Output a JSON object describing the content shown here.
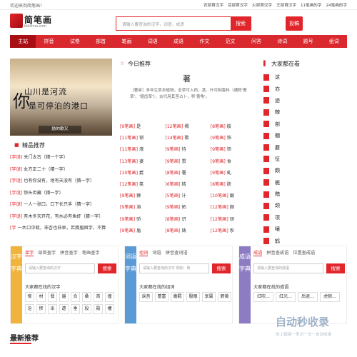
{
  "topbar": {
    "welcome": "欢迎来到简笔画！",
    "links": [
      "农部首汉字",
      "耳部首汉字",
      "火部首汉字",
      "王部首汉字",
      "11笔画的字",
      "24笔画的字"
    ]
  },
  "logo": {
    "name": "简笔画",
    "sub": "biblihua.com"
  },
  "search": {
    "placeholder": "请输入要查询的汉字，词语，成语",
    "button": "搜索"
  },
  "login": "投稿",
  "nav": [
    "主站",
    "拼音",
    "试卷",
    "部首",
    "笔画",
    "词语",
    "成语",
    "作文",
    "范文",
    "问答",
    "诗词",
    "题号",
    "组词"
  ],
  "hero": {
    "line1": "山川是河流",
    "line2": "是可停泊的港口",
    "big": "你",
    "caption": "励的歌又"
  },
  "jingpin": {
    "title": "精品推荐",
    "items": [
      {
        "tag": "[字谜]",
        "text": "关门太古（猜一个字）"
      },
      {
        "tag": "[字谜]",
        "text": "女方正二十（猜一字）"
      },
      {
        "tag": "[字谜]",
        "text": "也有你没有，地有天没有（猜一字）"
      },
      {
        "tag": "[字谜]",
        "text": "惊头否藏（猜一字）"
      },
      {
        "tag": "[字谜]",
        "text": "一人一张口，口下长只手（猜一字）"
      },
      {
        "tag": "[字谜]",
        "text": "有木冬天开花，有水必有鱼虾（猜一字）"
      },
      {
        "tag": "[字",
        "text": "一木口中栽，非杏也非呆，若猜盾困字，不算"
      }
    ]
  },
  "today": {
    "title": "今日推荐",
    "char": "著",
    "desc": "［著审］多年生草本植物，全草可入药，茎、叶可制香料（通称'蓍草'、'锯齿草'），古代用其茎占卜，称'蓍龟'。"
  },
  "strokes": [
    [
      {
        "tag": "[9笔画]",
        "c": "是"
      },
      {
        "tag": "[12笔画]",
        "c": "揭"
      },
      {
        "tag": "[8笔画]",
        "c": "肢"
      }
    ],
    [
      {
        "tag": "[11笔画]",
        "c": "锁"
      },
      {
        "tag": "[14笔画]",
        "c": "歌"
      },
      {
        "tag": "[9笔画]",
        "c": "饰"
      }
    ],
    [
      {
        "tag": "[11笔画]",
        "c": "液"
      },
      {
        "tag": "[9笔画]",
        "c": "恃"
      },
      {
        "tag": "[9笔画]",
        "c": "饰"
      }
    ],
    [
      {
        "tag": "[13笔画]",
        "c": "婆"
      },
      {
        "tag": "[9笔画]",
        "c": "贯"
      },
      {
        "tag": "[9笔画]",
        "c": "食"
      }
    ],
    [
      {
        "tag": "[10笔画]",
        "c": "爵"
      },
      {
        "tag": "[8笔画]",
        "c": "署"
      },
      {
        "tag": "[9笔画]",
        "c": "虬"
      }
    ],
    [
      {
        "tag": "[12笔画]",
        "c": "笑"
      },
      {
        "tag": "[6笔画]",
        "c": "桔"
      },
      {
        "tag": "[8笔画]",
        "c": "肤"
      }
    ],
    [
      {
        "tag": "[9笔画]",
        "c": "狮"
      },
      {
        "tag": "[5笔画]",
        "c": "汁"
      },
      {
        "tag": "[10笔画]",
        "c": "蹴"
      }
    ],
    [
      {
        "tag": "[9笔画]",
        "c": "涛"
      },
      {
        "tag": "[9笔画]",
        "c": "拓"
      },
      {
        "tag": "[12笔画]",
        "c": "颇"
      }
    ],
    [
      {
        "tag": "[9笔画]",
        "c": "骄"
      },
      {
        "tag": "[8笔画]",
        "c": "识"
      },
      {
        "tag": "[12笔画]",
        "c": "顽"
      }
    ],
    [
      {
        "tag": "[9笔画]",
        "c": "盾"
      },
      {
        "tag": "[8笔画]",
        "c": "铸"
      },
      {
        "tag": "[12笔画]",
        "c": "豕"
      }
    ]
  ],
  "hot": {
    "title": "大家都在看",
    "items": [
      "这",
      "亦",
      "迹",
      "棘",
      "剖",
      "棚",
      "蘑",
      "怔",
      "颇",
      "栀",
      "黯",
      "颉",
      "项",
      "嚷",
      "鹤"
    ]
  },
  "panels": {
    "zi": {
      "side": "汉字字典",
      "tabs": [
        "单字",
        "部首查字",
        "拼音查字",
        "笔画查字"
      ],
      "placeholder": "请输入要查询的汉字",
      "button": "搜索",
      "label": "大家都在找的汉字",
      "chars": [
        "惭",
        "材",
        "餐",
        "遍",
        "合",
        "桑",
        "首",
        "撞",
        "沧",
        "惨",
        "采",
        "遭",
        "垂",
        "段",
        "殿",
        "槽"
      ]
    },
    "ci": {
      "side": "词语字典",
      "tabs": [
        "组词",
        "词语",
        "拼音查词语"
      ],
      "placeholder": "请输入要查询的汉字 例如：阿",
      "button": "搜索",
      "label": "大家都在找的组词",
      "words": [
        "诶音",
        "蕾富",
        "庵羁",
        "殷眼",
        "享属",
        "野黄"
      ]
    },
    "cheng": {
      "side": "成语字典",
      "tabs": [
        "成语",
        "拼音查成语",
        "位置查成语"
      ],
      "placeholder": "请输入要查询的成语",
      "button": "搜索",
      "label": "大家都在找的成语",
      "idioms": [
        "红吹...",
        "红光...",
        "后退...",
        "虎狼..."
      ]
    }
  },
  "latest": "最新推荐",
  "watermark": {
    "title": "自动秒收录",
    "sub": "放上链接一来访一次一自动收录"
  }
}
